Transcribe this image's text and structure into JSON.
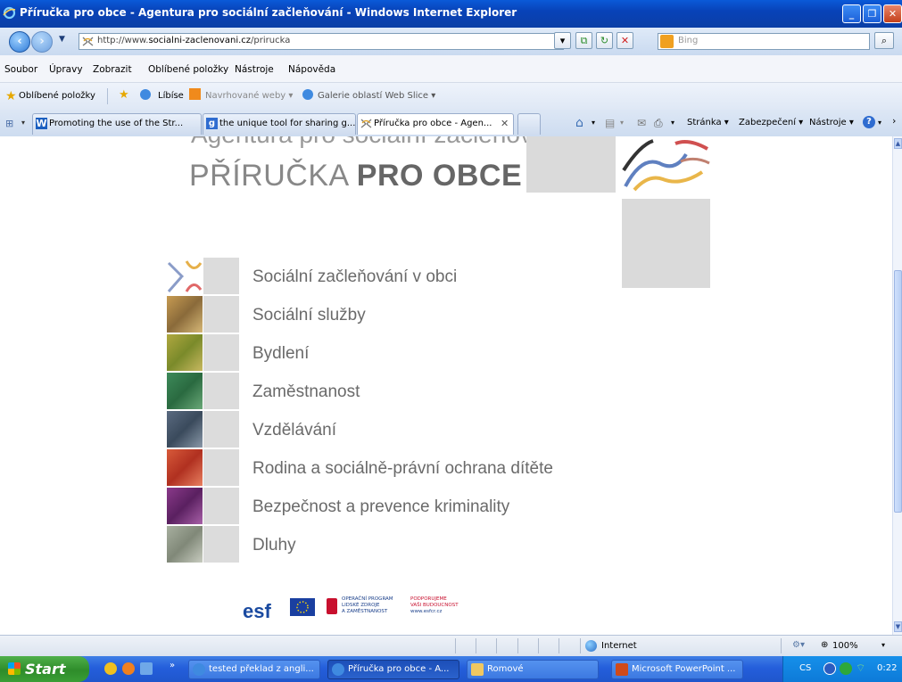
{
  "window": {
    "title": "Příručka pro obce - Agentura pro sociální začleňování - Windows Internet Explorer"
  },
  "address": {
    "url_prefix": "http://www.",
    "url_domain": "socialni-zaclenovani.cz",
    "url_path": "/prirucka",
    "search_placeholder": "Bing"
  },
  "menu": [
    "Soubor",
    "Úpravy",
    "Zobrazit",
    "Oblíbené položky",
    "Nástroje",
    "Nápověda"
  ],
  "favorites": {
    "label": "Oblíbené položky",
    "items": [
      "Líbíse",
      "Navrhované weby ▾",
      "Galerie oblastí Web Slice ▾"
    ]
  },
  "tabs": [
    {
      "label": "Promoting the use of the Str..."
    },
    {
      "label": "the unique tool for sharing g..."
    },
    {
      "label": "Příručka pro obce - Agen..."
    }
  ],
  "toolbar": {
    "stranka": "Stránka ▾",
    "zabezpeceni": "Zabezpečení ▾",
    "nastroje": "Nástroje ▾"
  },
  "page": {
    "cut_title": "Agentura pro sociální začleňování",
    "title_light": "PŘÍRUČKA ",
    "title_bold": "PRO OBCE",
    "items": [
      "Sociální začleňování v obci",
      "Sociální služby",
      "Bydlení",
      "Zaměstnanost",
      "Vzdělávání",
      "Rodina a sociálně-právní ochrana dítěte",
      "Bezpečnost a prevence kriminality",
      "Dluhy"
    ],
    "footer": {
      "esf": "esf",
      "op_line1": "OPERAČNÍ PROGRAM",
      "op_line2": "LIDSKÉ ZDROJE",
      "op_line3": "A ZAMĚSTNANOST",
      "slogan1": "PODPORUJEME",
      "slogan2": "VAŠI BUDOUCNOST",
      "web": "www.esfcr.cz"
    }
  },
  "status": {
    "zone": "Internet",
    "zoom": "100%"
  },
  "taskbar": {
    "start": "Start",
    "buttons": [
      "tested překlad z angli...",
      "Příručka pro obce - A...",
      "Romové",
      "Microsoft PowerPoint ..."
    ],
    "lang": "CS",
    "clock": "0:22"
  },
  "colors": {
    "title_bar": "#0842b8",
    "taskbar": "#245edb",
    "start_green": "#3a9e35",
    "page_grey": "#dadada",
    "menu_text": "#6a6a6a"
  }
}
